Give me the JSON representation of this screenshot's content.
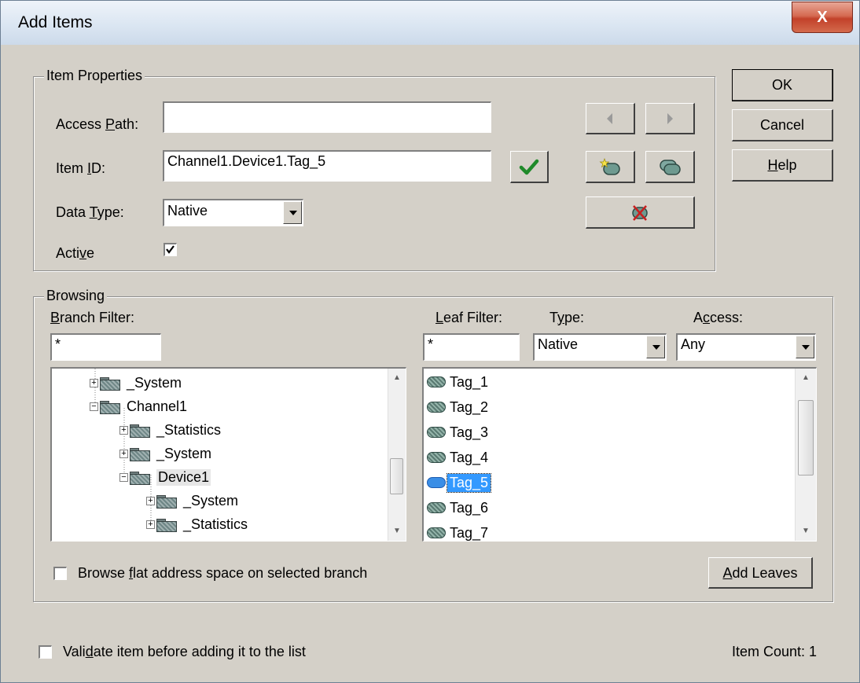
{
  "window": {
    "title": "Add Items",
    "close_label": "X"
  },
  "item_properties": {
    "legend": "Item Properties",
    "access_path_label": "Access Path:",
    "access_path_value": "",
    "item_id_label": "Item ID:",
    "item_id_value": "Channel1.Device1.Tag_5",
    "data_type_label": "Data Type:",
    "data_type_value": "Native",
    "active_label": "Active",
    "active_checked": true
  },
  "dialog_buttons": {
    "ok": "OK",
    "cancel": "Cancel",
    "help": "Help"
  },
  "browsing": {
    "legend": "Browsing",
    "branch_filter_label": "Branch Filter:",
    "branch_filter_value": "*",
    "leaf_filter_label": "Leaf Filter:",
    "leaf_filter_value": "*",
    "type_label": "Type:",
    "type_value": "Native",
    "access_label": "Access:",
    "access_value": "Any",
    "tree": [
      {
        "label": "_System",
        "level": 1,
        "expander": "+"
      },
      {
        "label": "Channel1",
        "level": 1,
        "expander": "−"
      },
      {
        "label": "_Statistics",
        "level": 2,
        "expander": "+"
      },
      {
        "label": "_System",
        "level": 2,
        "expander": "+"
      },
      {
        "label": "Device1",
        "level": 2,
        "expander": "−",
        "selected": true
      },
      {
        "label": "_System",
        "level": 3,
        "expander": "+"
      },
      {
        "label": "_Statistics",
        "level": 3,
        "expander": "+"
      }
    ],
    "leaves": [
      "Tag_1",
      "Tag_2",
      "Tag_3",
      "Tag_4",
      "Tag_5",
      "Tag_6",
      "Tag_7"
    ],
    "selected_leaf": "Tag_5",
    "flat_browse_label": "Browse flat address space on selected branch",
    "add_leaves_label": "Add Leaves"
  },
  "footer": {
    "validate_label": "Validate item before adding it to the list",
    "item_count_text": "Item Count: 1"
  }
}
